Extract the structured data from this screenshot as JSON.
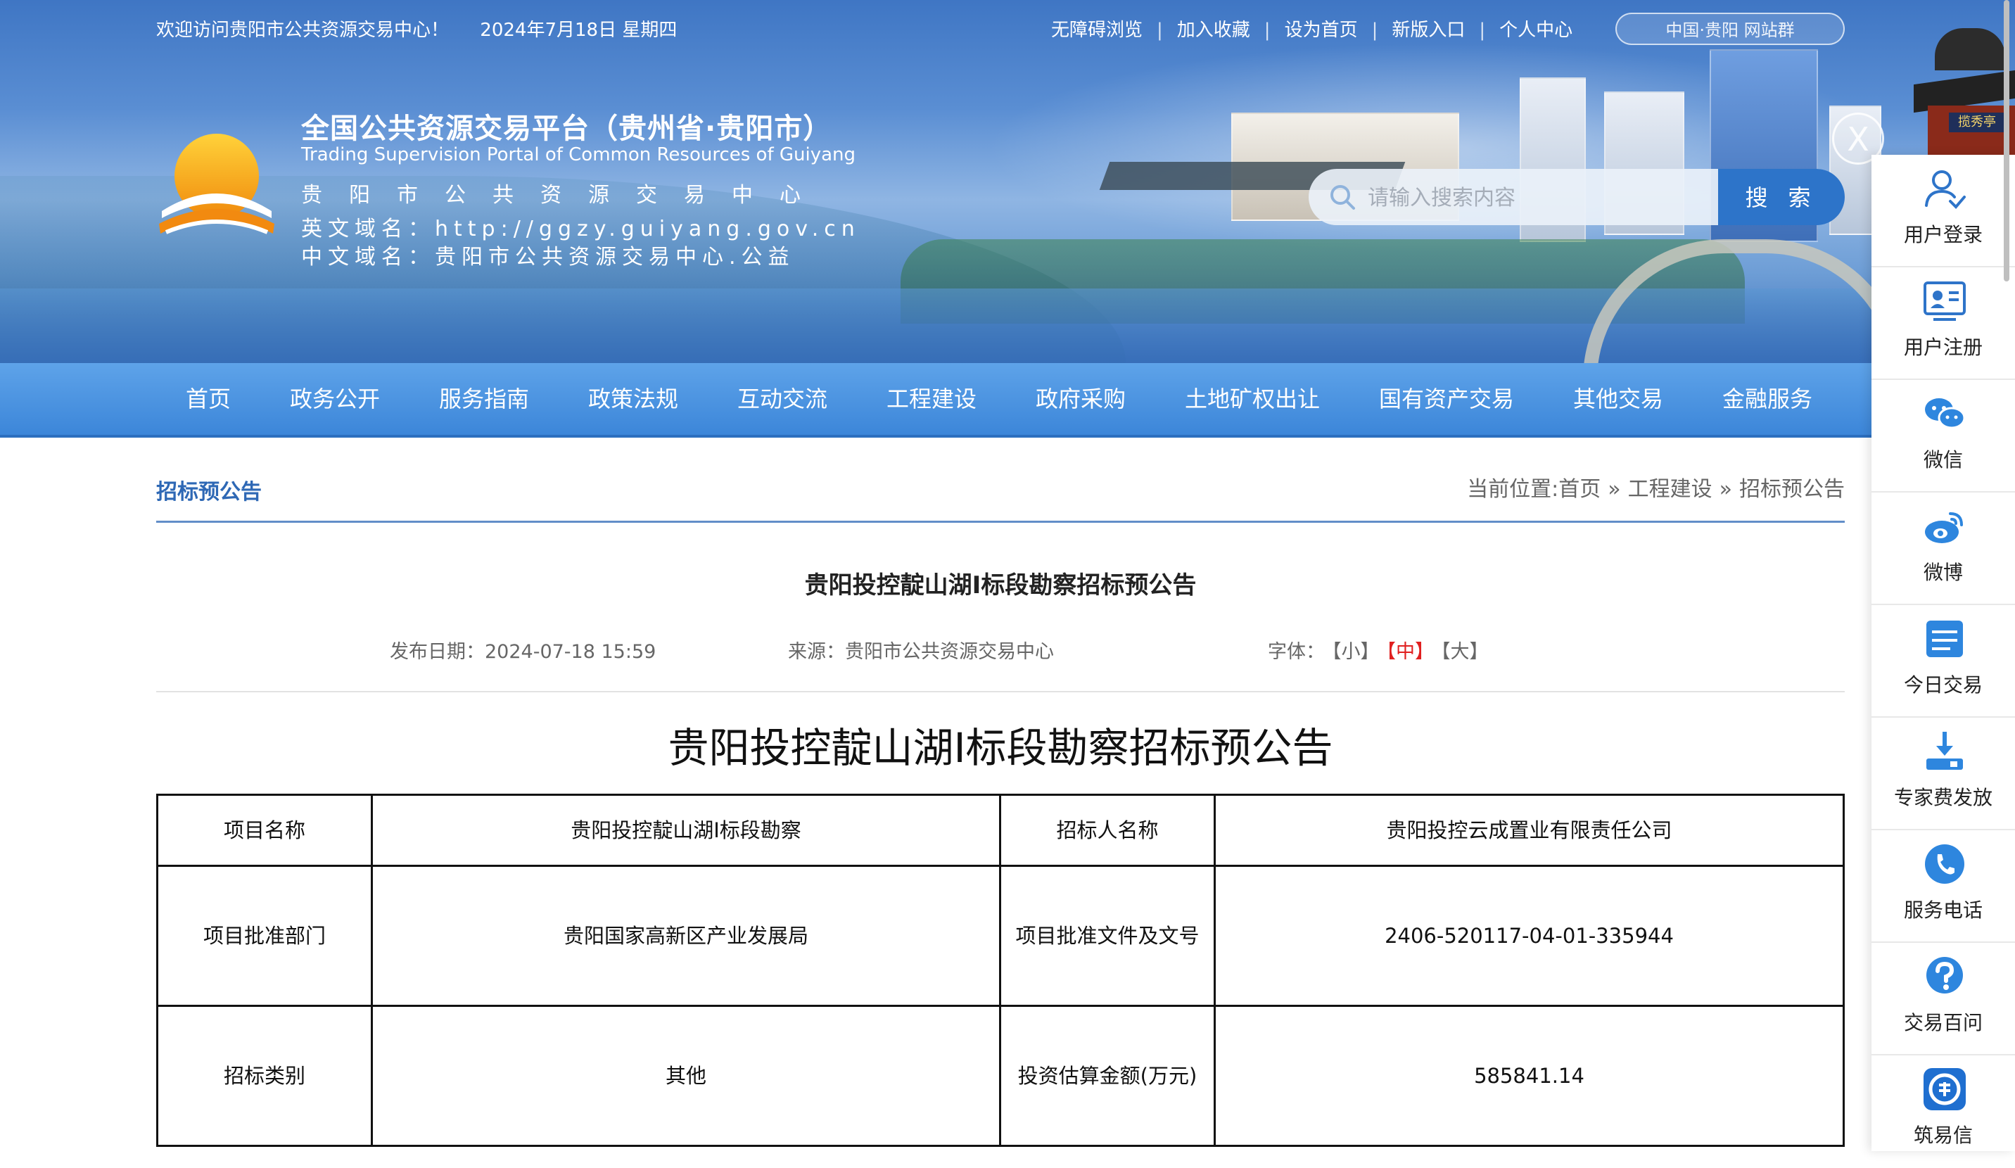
{
  "topbar": {
    "welcome": "欢迎访问贵阳市公共资源交易中心！",
    "date": "2024年7月18日 星期四",
    "links": [
      "无障碍浏览",
      "加入收藏",
      "设为首页",
      "新版入口",
      "个人中心"
    ],
    "site_group": "中国·贵阳 网站群"
  },
  "brand": {
    "title": "全国公共资源交易平台（贵州省·贵阳市）",
    "subtitle_en": "Trading Supervision Portal of Common Resources of Guiyang",
    "org_name": "贵阳市公共资源交易中心",
    "domain_en": "英文域名：http://ggzy.guiyang.gov.cn",
    "domain_cn": "中文域名：贵阳市公共资源交易中心.公益"
  },
  "search": {
    "placeholder": "请输入搜索内容",
    "button": "搜 索"
  },
  "close_label": "X",
  "nav": [
    "首页",
    "政务公开",
    "服务指南",
    "政策法规",
    "互动交流",
    "工程建设",
    "政府采购",
    "土地矿权出让",
    "国有资产交易",
    "其他交易",
    "金融服务"
  ],
  "section": {
    "title": "招标预公告",
    "breadcrumb_prefix": "当前位置:",
    "breadcrumb": [
      "首页",
      "工程建设",
      "招标预公告"
    ],
    "breadcrumb_sep": "»"
  },
  "article": {
    "title": "贵阳投控靛山湖Ⅰ标段勘察招标预公告",
    "publish_label": "发布日期：",
    "publish_date": "2024-07-18 15:59",
    "source_label": "来源：",
    "source": "贵阳市公共资源交易中心",
    "font_label": "字体：",
    "font_small": "【小】",
    "font_medium": "【中】",
    "font_large": "【大】",
    "doc_title": "贵阳投控靛山湖Ⅰ标段勘察招标预公告"
  },
  "table": {
    "rows": [
      [
        "项目名称",
        "贵阳投控靛山湖Ⅰ标段勘察",
        "招标人名称",
        "贵阳投控云成置业有限责任公司"
      ],
      [
        "项目批准部门",
        "贵阳国家高新区产业发展局",
        "项目批准文件及文号",
        "2406-520117-04-01-335944"
      ],
      [
        "招标类别",
        "其他",
        "投资估算金额(万元)",
        "585841.14"
      ]
    ]
  },
  "sidebar": [
    {
      "label": "用户登录",
      "icon": "user-login-icon"
    },
    {
      "label": "用户注册",
      "icon": "user-register-icon"
    },
    {
      "label": "微信",
      "icon": "wechat-icon"
    },
    {
      "label": "微博",
      "icon": "weibo-icon"
    },
    {
      "label": "今日交易",
      "icon": "today-trade-icon"
    },
    {
      "label": "专家费发放",
      "icon": "expert-fee-icon"
    },
    {
      "label": "服务电话",
      "icon": "phone-icon"
    },
    {
      "label": "交易百问",
      "icon": "question-icon"
    },
    {
      "label": "筑易信",
      "icon": "zhuyixin-icon"
    }
  ],
  "pavilion_sign": "揽秀亭",
  "colors": {
    "nav": "#4a93e0",
    "accent": "#2e68b5",
    "active_font": "#e02020",
    "search_btn": "#2d74c9"
  }
}
